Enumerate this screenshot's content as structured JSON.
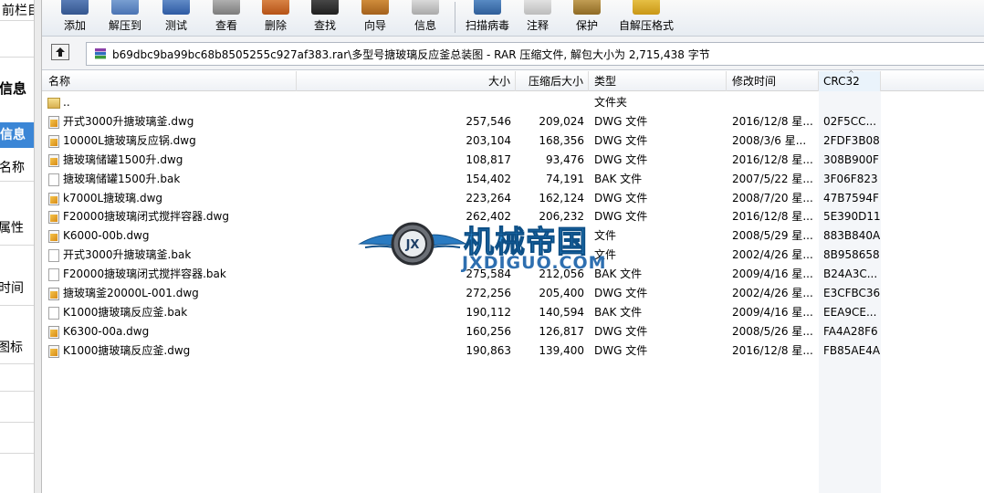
{
  "sidebar": {
    "items": [
      "前栏目",
      "信息",
      "信息",
      "名称",
      "属性",
      "时间",
      "图标"
    ]
  },
  "toolbar": {
    "buttons": [
      {
        "label": "添加",
        "icon": "add-icon"
      },
      {
        "label": "解压到",
        "icon": "extract-icon"
      },
      {
        "label": "测试",
        "icon": "test-icon"
      },
      {
        "label": "查看",
        "icon": "view-icon"
      },
      {
        "label": "删除",
        "icon": "delete-icon"
      },
      {
        "label": "查找",
        "icon": "find-icon"
      },
      {
        "label": "向导",
        "icon": "wizard-icon"
      },
      {
        "label": "信息",
        "icon": "info-icon"
      },
      {
        "label": "扫描病毒",
        "icon": "virus-scan-icon"
      },
      {
        "label": "注释",
        "icon": "comment-icon"
      },
      {
        "label": "保护",
        "icon": "protect-icon"
      },
      {
        "label": "自解压格式",
        "icon": "sfx-icon"
      }
    ]
  },
  "address": {
    "path": "b69dbc9ba99bc68b8505255c927af383.rar\\多型号搪玻璃反应釜总装图 - RAR 压缩文件, 解包大小为 2,715,438 字节"
  },
  "columns": {
    "name": "名称",
    "size": "大小",
    "packed": "压缩后大小",
    "type": "类型",
    "modified": "修改时间",
    "crc": "CRC32"
  },
  "rows": [
    {
      "name": "..",
      "size": "",
      "packed": "",
      "type": "文件夹",
      "modified": "",
      "crc": "",
      "kind": "folder"
    },
    {
      "name": "开式3000升搪玻璃釜.dwg",
      "size": "257,546",
      "packed": "209,024",
      "type": "DWG 文件",
      "modified": "2016/12/8 星...",
      "crc": "02F5CC...",
      "kind": "dwg"
    },
    {
      "name": "10000L搪玻璃反应锅.dwg",
      "size": "203,104",
      "packed": "168,356",
      "type": "DWG 文件",
      "modified": "2008/3/6 星...",
      "crc": "2FDF3B08",
      "kind": "dwg"
    },
    {
      "name": "搪玻璃储罐1500升.dwg",
      "size": "108,817",
      "packed": "93,476",
      "type": "DWG 文件",
      "modified": "2016/12/8 星...",
      "crc": "308B900F",
      "kind": "dwg"
    },
    {
      "name": "搪玻璃储罐1500升.bak",
      "size": "154,402",
      "packed": "74,191",
      "type": "BAK 文件",
      "modified": "2007/5/22 星...",
      "crc": "3F06F823",
      "kind": "bak"
    },
    {
      "name": "k7000L搪玻璃.dwg",
      "size": "223,264",
      "packed": "162,124",
      "type": "DWG 文件",
      "modified": "2008/7/20 星...",
      "crc": "47B7594F",
      "kind": "dwg"
    },
    {
      "name": "F20000搪玻璃闭式搅拌容器.dwg",
      "size": "262,402",
      "packed": "206,232",
      "type": "DWG 文件",
      "modified": "2016/12/8 星...",
      "crc": "5E390D11",
      "kind": "dwg"
    },
    {
      "name": "K6000-00b.dwg",
      "size": "",
      "packed": "",
      "type": "文件",
      "modified": "2008/5/29 星...",
      "crc": "883B840A",
      "kind": "dwg"
    },
    {
      "name": "开式3000升搪玻璃釜.bak",
      "size": "",
      "packed": "",
      "type": "文件",
      "modified": "2002/4/26 星...",
      "crc": "8B958658",
      "kind": "bak"
    },
    {
      "name": "F20000搪玻璃闭式搅拌容器.bak",
      "size": "275,584",
      "packed": "212,056",
      "type": "BAK 文件",
      "modified": "2009/4/16 星...",
      "crc": "B24A3C...",
      "kind": "bak"
    },
    {
      "name": "搪玻璃釜20000L-001.dwg",
      "size": "272,256",
      "packed": "205,400",
      "type": "DWG 文件",
      "modified": "2002/4/26 星...",
      "crc": "E3CFBC36",
      "kind": "dwg"
    },
    {
      "name": "K1000搪玻璃反应釜.bak",
      "size": "190,112",
      "packed": "140,594",
      "type": "BAK 文件",
      "modified": "2009/4/16 星...",
      "crc": "EEA9CE...",
      "kind": "bak"
    },
    {
      "name": "K6300-00a.dwg",
      "size": "160,256",
      "packed": "126,817",
      "type": "DWG 文件",
      "modified": "2008/5/26 星...",
      "crc": "FA4A28F6",
      "kind": "dwg"
    },
    {
      "name": "K1000搪玻璃反应釜.dwg",
      "size": "190,863",
      "packed": "139,400",
      "type": "DWG 文件",
      "modified": "2016/12/8 星...",
      "crc": "FB85AE4A",
      "kind": "dwg"
    }
  ],
  "watermark": {
    "title": "机械帝国",
    "url": "JXDIGUO.COM",
    "logo_letters": "JX"
  },
  "colors": {
    "selected_sidebar": "#3b86d6",
    "watermark_blue": "#2f8fd4"
  }
}
